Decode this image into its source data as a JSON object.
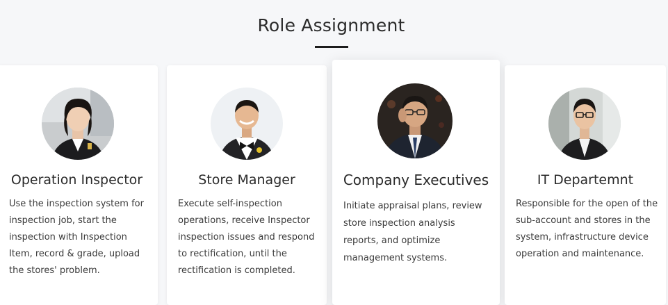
{
  "section": {
    "title": "Role Assignment"
  },
  "roles": [
    {
      "title": "Operation Inspector",
      "description": "Use the inspection system for inspection job, start the inspection with Inspection Item, record & grade, upload the stores' problem.",
      "avatar_icon": "person-woman-avatar"
    },
    {
      "title": "Store Manager",
      "description": "Execute self-inspection operations, receive Inspector inspection issues and respond to rectification, until the rectification is completed.",
      "avatar_icon": "person-bowtie-avatar"
    },
    {
      "title": "Company Executives",
      "description": "Initiate appraisal plans, review store inspection analysis reports, and optimize management systems.",
      "avatar_icon": "person-executive-avatar"
    },
    {
      "title": "IT Departemnt",
      "description": "Responsible for the open of the sub-account and stores in the system, infrastructure device operation and maintenance.",
      "avatar_icon": "person-glasses-avatar"
    }
  ],
  "colors": {
    "background": "#f6f7f9",
    "card": "#ffffff",
    "title": "#2b2b2b",
    "underline": "#1d1d1d",
    "text": "#3a3a3a"
  }
}
